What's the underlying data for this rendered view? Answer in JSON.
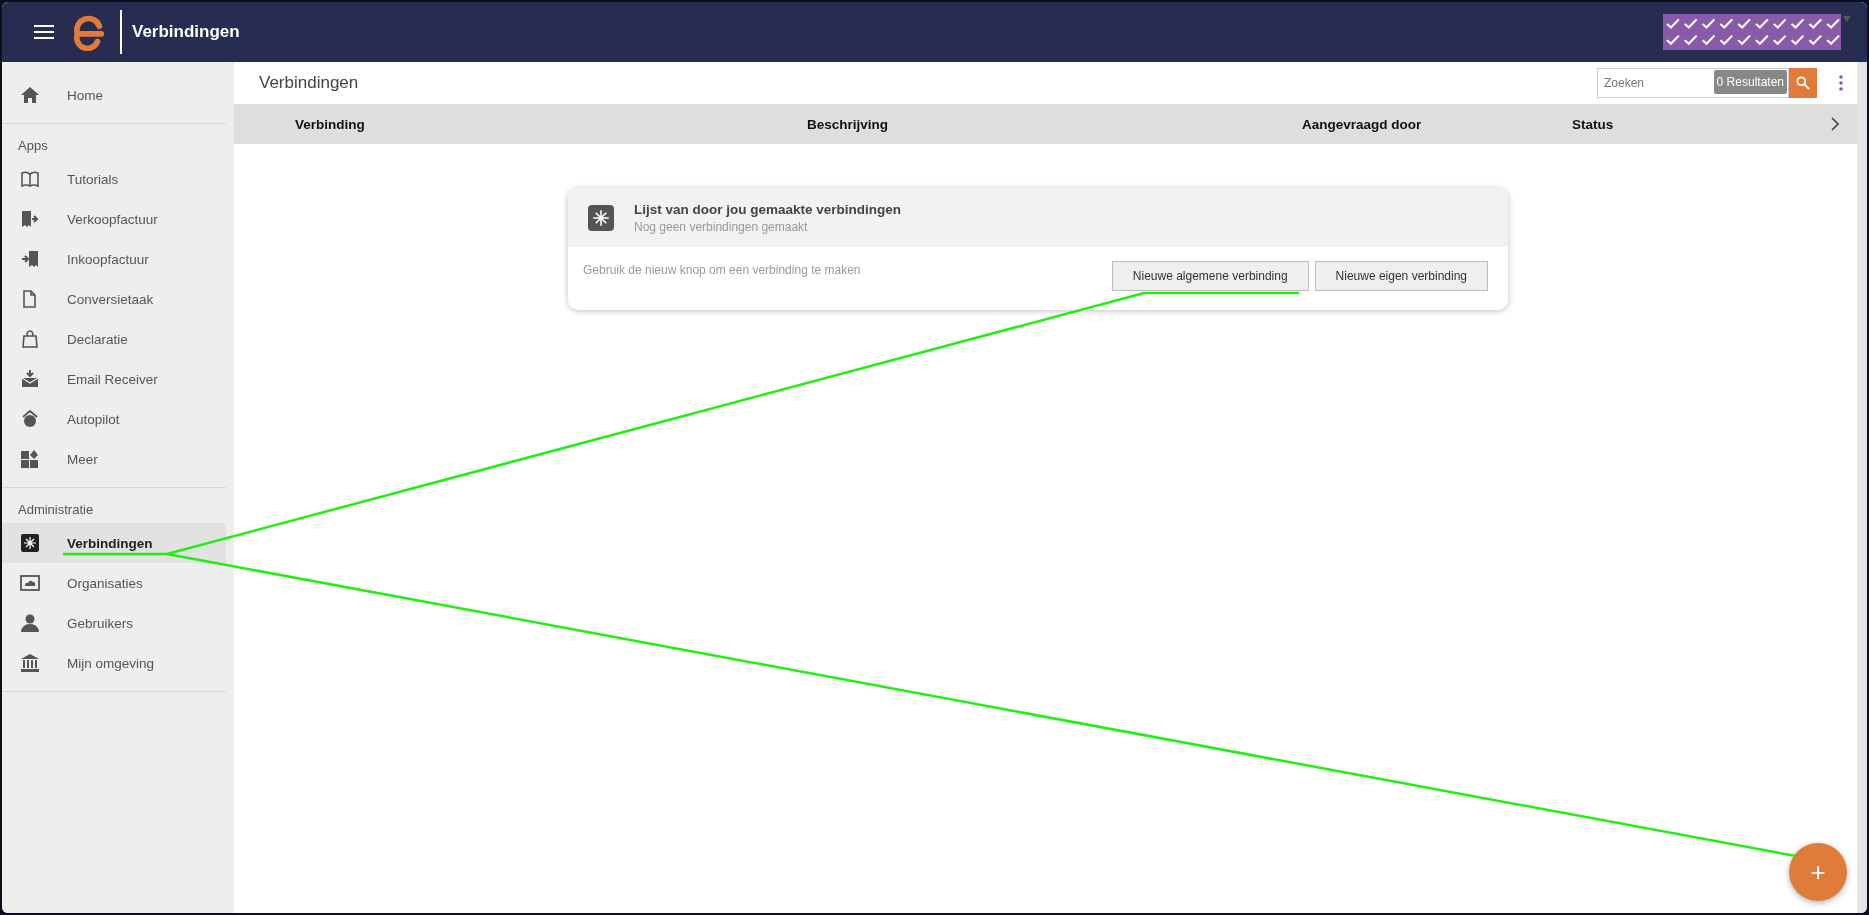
{
  "app_bar": {
    "title": "Verbindingen"
  },
  "sidebar": {
    "sections": [
      {
        "items": [
          {
            "label": "Home",
            "selected": false
          }
        ]
      },
      {
        "title": "Apps",
        "items": [
          {
            "label": "Tutorials",
            "selected": false
          },
          {
            "label": "Verkoopfactuur",
            "selected": false
          },
          {
            "label": "Inkoopfactuur",
            "selected": false
          },
          {
            "label": "Conversietaak",
            "selected": false
          },
          {
            "label": "Declaratie",
            "selected": false
          },
          {
            "label": "Email Receiver",
            "selected": false
          },
          {
            "label": "Autopilot",
            "selected": false
          },
          {
            "label": "Meer",
            "selected": false
          }
        ]
      },
      {
        "title": "Administratie",
        "items": [
          {
            "label": "Verbindingen",
            "selected": true
          },
          {
            "label": "Organisaties",
            "selected": false
          },
          {
            "label": "Gebruikers",
            "selected": false
          },
          {
            "label": "Mijn omgeving",
            "selected": false
          }
        ]
      }
    ]
  },
  "page": {
    "title": "Verbindingen",
    "search": {
      "placeholder": "Zoeken",
      "results": "0 Resultaten"
    }
  },
  "table": {
    "columns": [
      "Verbinding",
      "Beschrijving",
      "Aangevraagd door",
      "Status"
    ]
  },
  "empty_card": {
    "title": "Lijst van door jou gemaakte verbindingen",
    "subtitle": "Nog geen verbindingen gemaakt",
    "hint": "Gebruik de nieuw knop om een verbinding te maken",
    "buttons": [
      "Nieuwe algemene verbinding",
      "Nieuwe eigen verbinding"
    ]
  },
  "fab": {
    "label": "+"
  }
}
